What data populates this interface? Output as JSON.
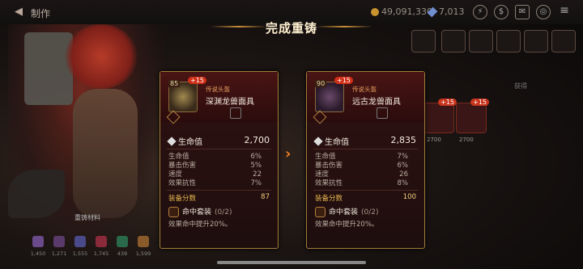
{
  "header": {
    "back_icon": "back-arrow-icon",
    "title": "制作",
    "gold": "49,091,330",
    "crystal": "7,013",
    "banner_title": "完成重铸"
  },
  "left_card": {
    "level": "85",
    "enhance": "+15",
    "rarity": "传说头盔",
    "name": "深渊龙兽面具",
    "main_stat_label": "生命值",
    "main_stat_value": "2,700",
    "substats": [
      {
        "label": "生命值",
        "value": "6%"
      },
      {
        "label": "暴击伤害",
        "value": "5%"
      },
      {
        "label": "速度",
        "value": "22"
      },
      {
        "label": "效果抗性",
        "value": "7%"
      }
    ],
    "score_label": "装备分数",
    "score_value": "87",
    "set_name": "命中套装",
    "set_count": "(0/2)",
    "set_effect": "效果命中提升20%。"
  },
  "right_card": {
    "level": "90",
    "enhance": "+15",
    "rarity": "传说头盔",
    "name": "远古龙兽面具",
    "main_stat_label": "生命值",
    "main_stat_value": "2,835",
    "substats": [
      {
        "label": "生命值",
        "value": "7%"
      },
      {
        "label": "暴击伤害",
        "value": "6%"
      },
      {
        "label": "速度",
        "value": "26"
      },
      {
        "label": "效果抗性",
        "value": "8%"
      }
    ],
    "score_label": "装备分数",
    "score_value": "100",
    "set_name": "命中套装",
    "set_count": "(0/2)",
    "set_effect": "效果命中提升20%。"
  },
  "background": {
    "materials_label": "重铸材料",
    "material_values": [
      "1,450",
      "1,271",
      "1,555",
      "1,745",
      "439",
      "1,599"
    ],
    "inventory_item_values": [
      "2700",
      "2700"
    ],
    "sort_label": "获得"
  },
  "colors": {
    "accent_orange": "#f08020",
    "gold_text": "#e8b850",
    "enhance_badge": "#d03018",
    "card_border": "#a07c3a"
  }
}
